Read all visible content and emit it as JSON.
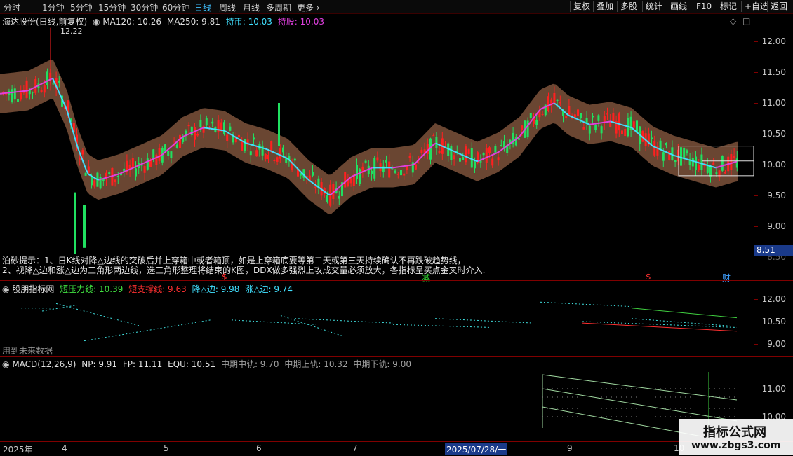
{
  "toolbar": {
    "tabs": [
      "分时",
      "1分钟",
      "5分钟",
      "15分钟",
      "30分钟",
      "60分钟",
      "日线",
      "周线",
      "月线",
      "多周期",
      "更多"
    ],
    "active_tab": "日线",
    "right_buttons": [
      "复权",
      "叠加",
      "多股",
      "统计",
      "画线",
      "F10",
      "标记",
      "+自选",
      "返回"
    ]
  },
  "main_panel": {
    "stock_title": "海达股份(日线,前复权)",
    "ma120": "MA120: 10.26",
    "ma250": "MA250: 9.81",
    "hold_coin": "持币: 10.03",
    "hold_stock": "持股: 10.03",
    "high_label": "12.22",
    "price_ticks": [
      "12.00",
      "11.50",
      "11.00",
      "10.50",
      "10.00",
      "9.50",
      "9.00",
      "8.50"
    ],
    "current_price": "8.51",
    "tip_line1": "泊砂提示：1、日K线对降△边线的突破后并上穿箱中或者箱顶，如是上穿箱底要等第二天或第三天持续确认不再跌破趋势线，",
    "tip_line2": "2、视降△边和涨△边为三角形两边线，选三角形整理将结束的K图，DDX做多强烈上攻成交量必须放大，各指标呈买点金叉时介入.",
    "markers": [
      {
        "text": "$",
        "color": "#ff3030"
      },
      {
        "text": "减",
        "color": "#30d030"
      },
      {
        "text": "$",
        "color": "#ff3030"
      },
      {
        "text": "财",
        "color": "#40a0ff"
      }
    ],
    "colors": {
      "up": "#ff2020",
      "down": "#20e060",
      "band": "#6a4632",
      "ma_cyan": "#40e0ff",
      "ma_magenta": "#e040e0"
    }
  },
  "indicator_panel": {
    "name": "股朋指标网",
    "short_resist": "短压力线: 10.39",
    "short_support": "短支撑线: 9.63",
    "down_edge": "降△边: 9.98",
    "up_edge": "涨△边: 9.74",
    "future_data_note": "用到未来数据",
    "ticks": [
      "12.00",
      "10.50",
      "9.00"
    ]
  },
  "macd_panel": {
    "title": "MACD(12,26,9)",
    "np": "NP: 9.91",
    "fp": "FP: 11.11",
    "equ": "EQU: 10.51",
    "mid": "中期中轨: 9.70",
    "upper": "中期上轨: 10.32",
    "lower": "中期下轨: 9.00",
    "ticks": [
      "11.00",
      "10.00"
    ]
  },
  "date_axis": {
    "labels": [
      "2025年",
      "4",
      "5",
      "6",
      "7",
      "2025/07/28/一",
      "9",
      "10"
    ]
  },
  "watermark": {
    "line1": "指标公式网",
    "line2": "www.zbgs3.com"
  }
}
